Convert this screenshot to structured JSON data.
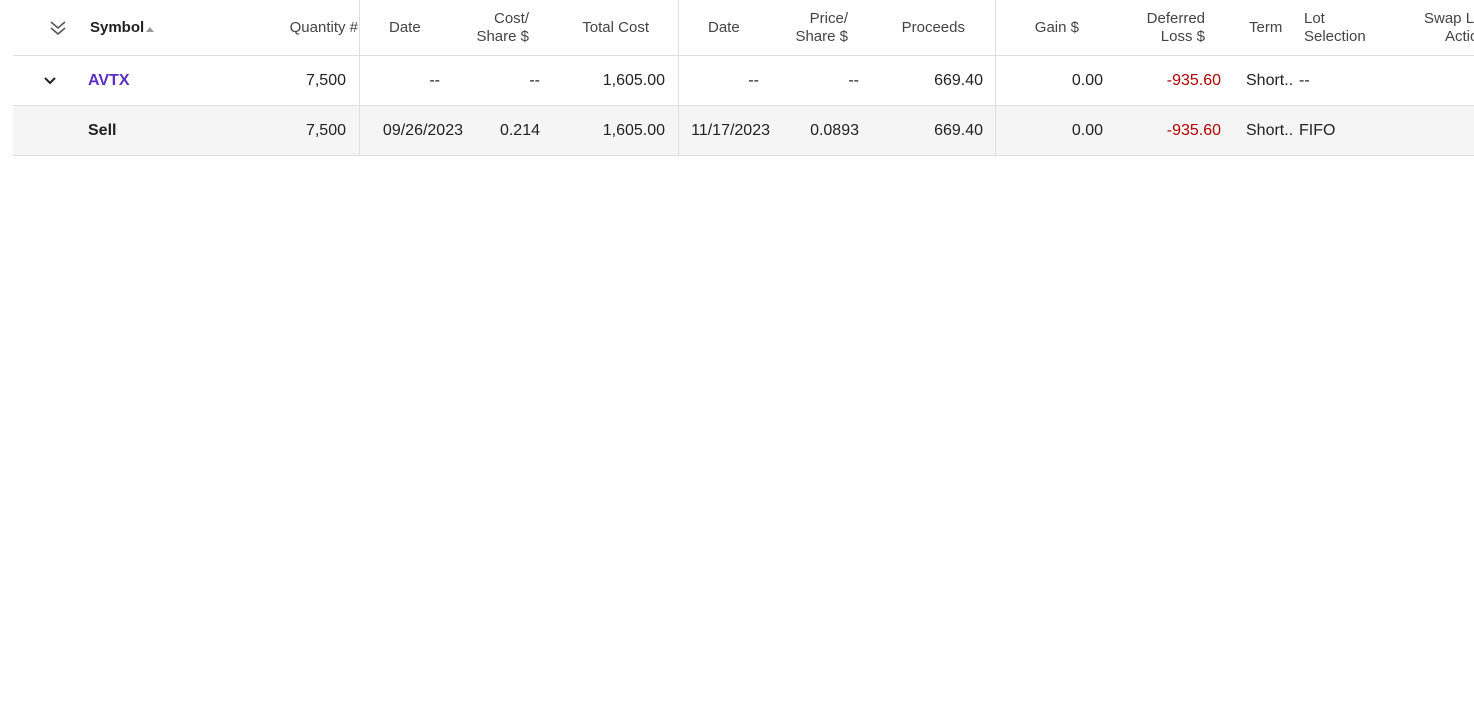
{
  "header": {
    "symbol": "Symbol",
    "quantity": "Quantity #",
    "acq_date": "Date",
    "cost_share_1": "Cost/",
    "cost_share_2": "Share $",
    "total_cost": "Total Cost",
    "sold_date": "Date",
    "price_share_1": "Price/",
    "price_share_2": "Share $",
    "proceeds": "Proceeds",
    "gain": "Gain $",
    "deferred_1": "Deferred",
    "deferred_2": "Loss $",
    "term": "Term",
    "lot_sel_1": "Lot",
    "lot_sel_2": "Selection",
    "swap_1": "Swap L",
    "swap_2": "Actio"
  },
  "rows": [
    {
      "symbol": "AVTX",
      "quantity": "7,500",
      "acq_date": "--",
      "cost_share": "--",
      "total_cost": "1,605.00",
      "sold_date": "--",
      "price_share": "--",
      "proceeds": "669.40",
      "gain": "0.00",
      "deferred_loss": "-935.60",
      "term": "Short..",
      "lot_selection": "--"
    },
    {
      "symbol": "Sell",
      "quantity": "7,500",
      "acq_date": "09/26/2023",
      "cost_share": "0.214",
      "total_cost": "1,605.00",
      "sold_date": "11/17/2023",
      "price_share": "0.0893",
      "proceeds": "669.40",
      "gain": "0.00",
      "deferred_loss": "-935.60",
      "term": "Short..",
      "lot_selection": "FIFO"
    }
  ],
  "icons": {
    "expand_all": "double-chevron-down-icon",
    "row_toggle": "chevron-down-icon"
  },
  "colors": {
    "symbol_link": "#5b2ec4",
    "negative": "#b00000",
    "lot_row_bg": "#f5f5f5"
  }
}
